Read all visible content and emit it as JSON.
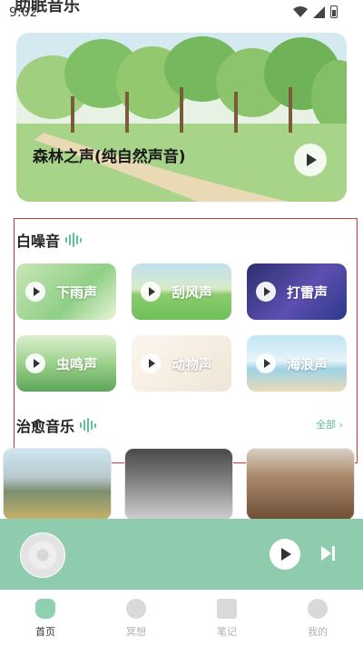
{
  "status_bar": {
    "time": "9:02",
    "app_title": "助眠音乐"
  },
  "hero": {
    "title": "森林之声(纯自然声音)"
  },
  "white_noise": {
    "title": "白噪音",
    "items": [
      {
        "label": "下雨声"
      },
      {
        "label": "刮风声"
      },
      {
        "label": "打雷声"
      },
      {
        "label": "虫鸣声"
      },
      {
        "label": "动物声"
      },
      {
        "label": "海浪声"
      }
    ]
  },
  "healing_music": {
    "title": "治愈音乐",
    "see_all": "全部 ›"
  },
  "tabs": [
    {
      "label": "首页"
    },
    {
      "label": "冥想"
    },
    {
      "label": "笔记"
    },
    {
      "label": "我的"
    }
  ],
  "colors": {
    "accent": "#8fccae",
    "active_tab": "#8fd0b0",
    "highlight_border": "#dd3333"
  }
}
